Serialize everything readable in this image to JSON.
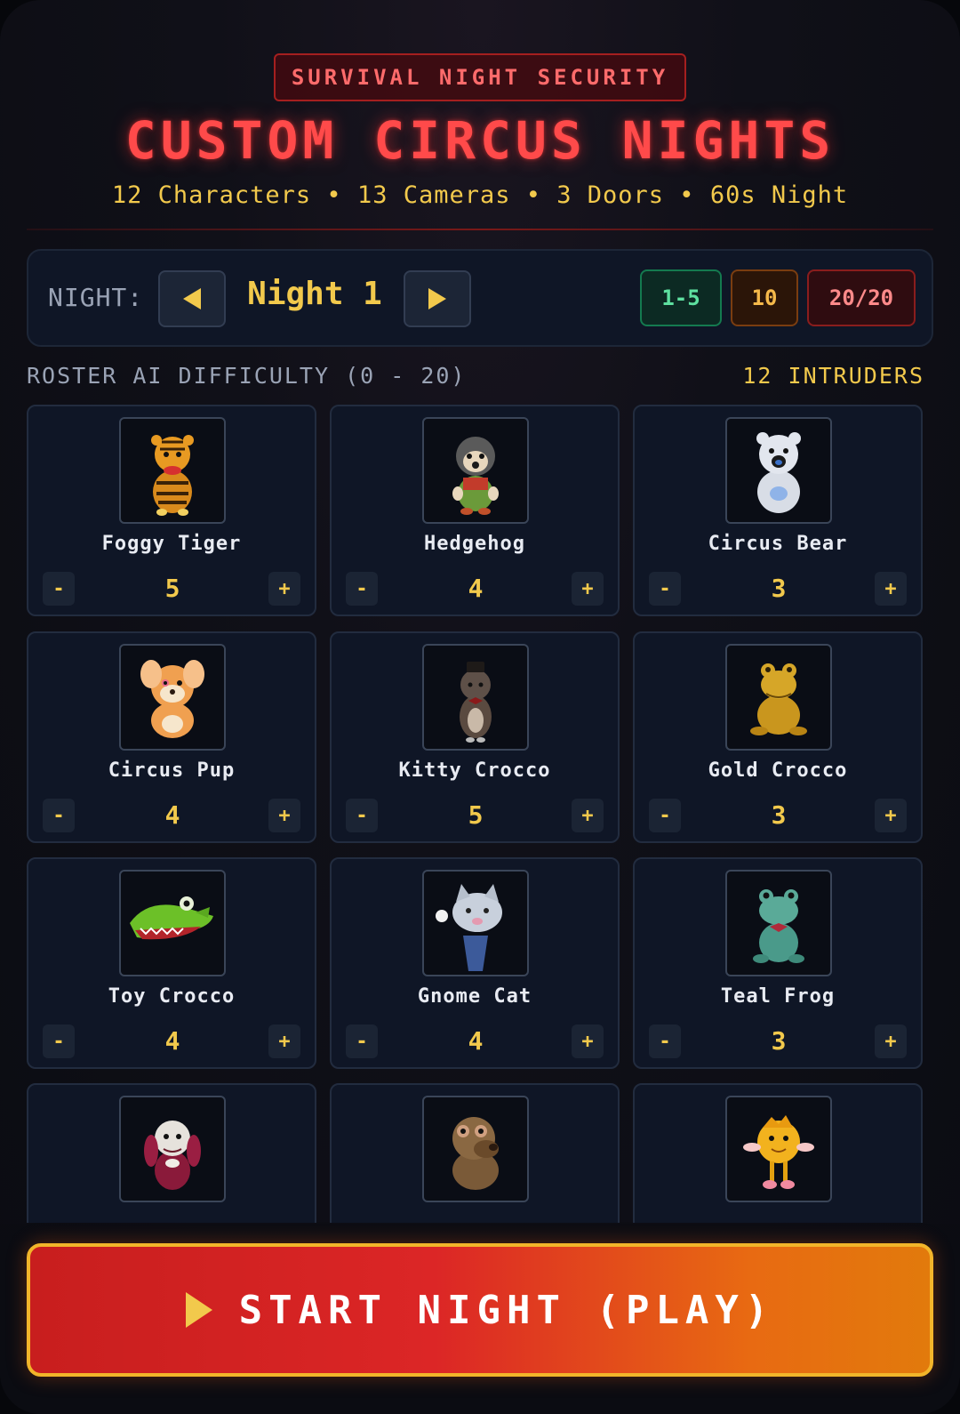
{
  "header": {
    "badge": "SURVIVAL NIGHT SECURITY",
    "title": "CUSTOM CIRCUS NIGHTS",
    "subtitle": "12 Characters • 13 Cameras • 3 Doors • 60s Night"
  },
  "night": {
    "label": "NIGHT:",
    "value": "Night 1",
    "presets": [
      "1-5",
      "10",
      "20/20"
    ]
  },
  "roster": {
    "title": "ROSTER AI DIFFICULTY (0 - 20)",
    "count": "12 INTRUDERS",
    "decrement_label": "-",
    "increment_label": "+",
    "characters": [
      {
        "name": "Foggy Tiger",
        "level": "5",
        "icon": "tiger-plush-icon"
      },
      {
        "name": "Hedgehog",
        "level": "4",
        "icon": "hedgehog-plush-icon"
      },
      {
        "name": "Circus Bear",
        "level": "3",
        "icon": "bear-plush-icon"
      },
      {
        "name": "Circus Pup",
        "level": "4",
        "icon": "pup-plush-icon"
      },
      {
        "name": "Kitty Crocco",
        "level": "5",
        "icon": "kitty-plush-icon"
      },
      {
        "name": "Gold Crocco",
        "level": "3",
        "icon": "gold-frog-plush-icon"
      },
      {
        "name": "Toy Crocco",
        "level": "4",
        "icon": "crocodile-plush-icon"
      },
      {
        "name": "Gnome Cat",
        "level": "4",
        "icon": "gnome-cat-plush-icon"
      },
      {
        "name": "Teal Frog",
        "level": "3",
        "icon": "teal-frog-plush-icon"
      },
      {
        "name": "",
        "level": "",
        "icon": "white-dog-plush-icon"
      },
      {
        "name": "",
        "level": "",
        "icon": "brown-bear-plush-icon"
      },
      {
        "name": "",
        "level": "",
        "icon": "yellow-plush-icon"
      }
    ]
  },
  "start": {
    "label": "START NIGHT (PLAY)",
    "icon": "play-icon"
  },
  "colors": {
    "accent_red": "#ff4a4a",
    "accent_yellow": "#f2c94c",
    "panel": "#0f1626",
    "preset_green": "#5ee0a0",
    "preset_orange": "#f5b94a",
    "preset_red": "#ff8a8a"
  }
}
